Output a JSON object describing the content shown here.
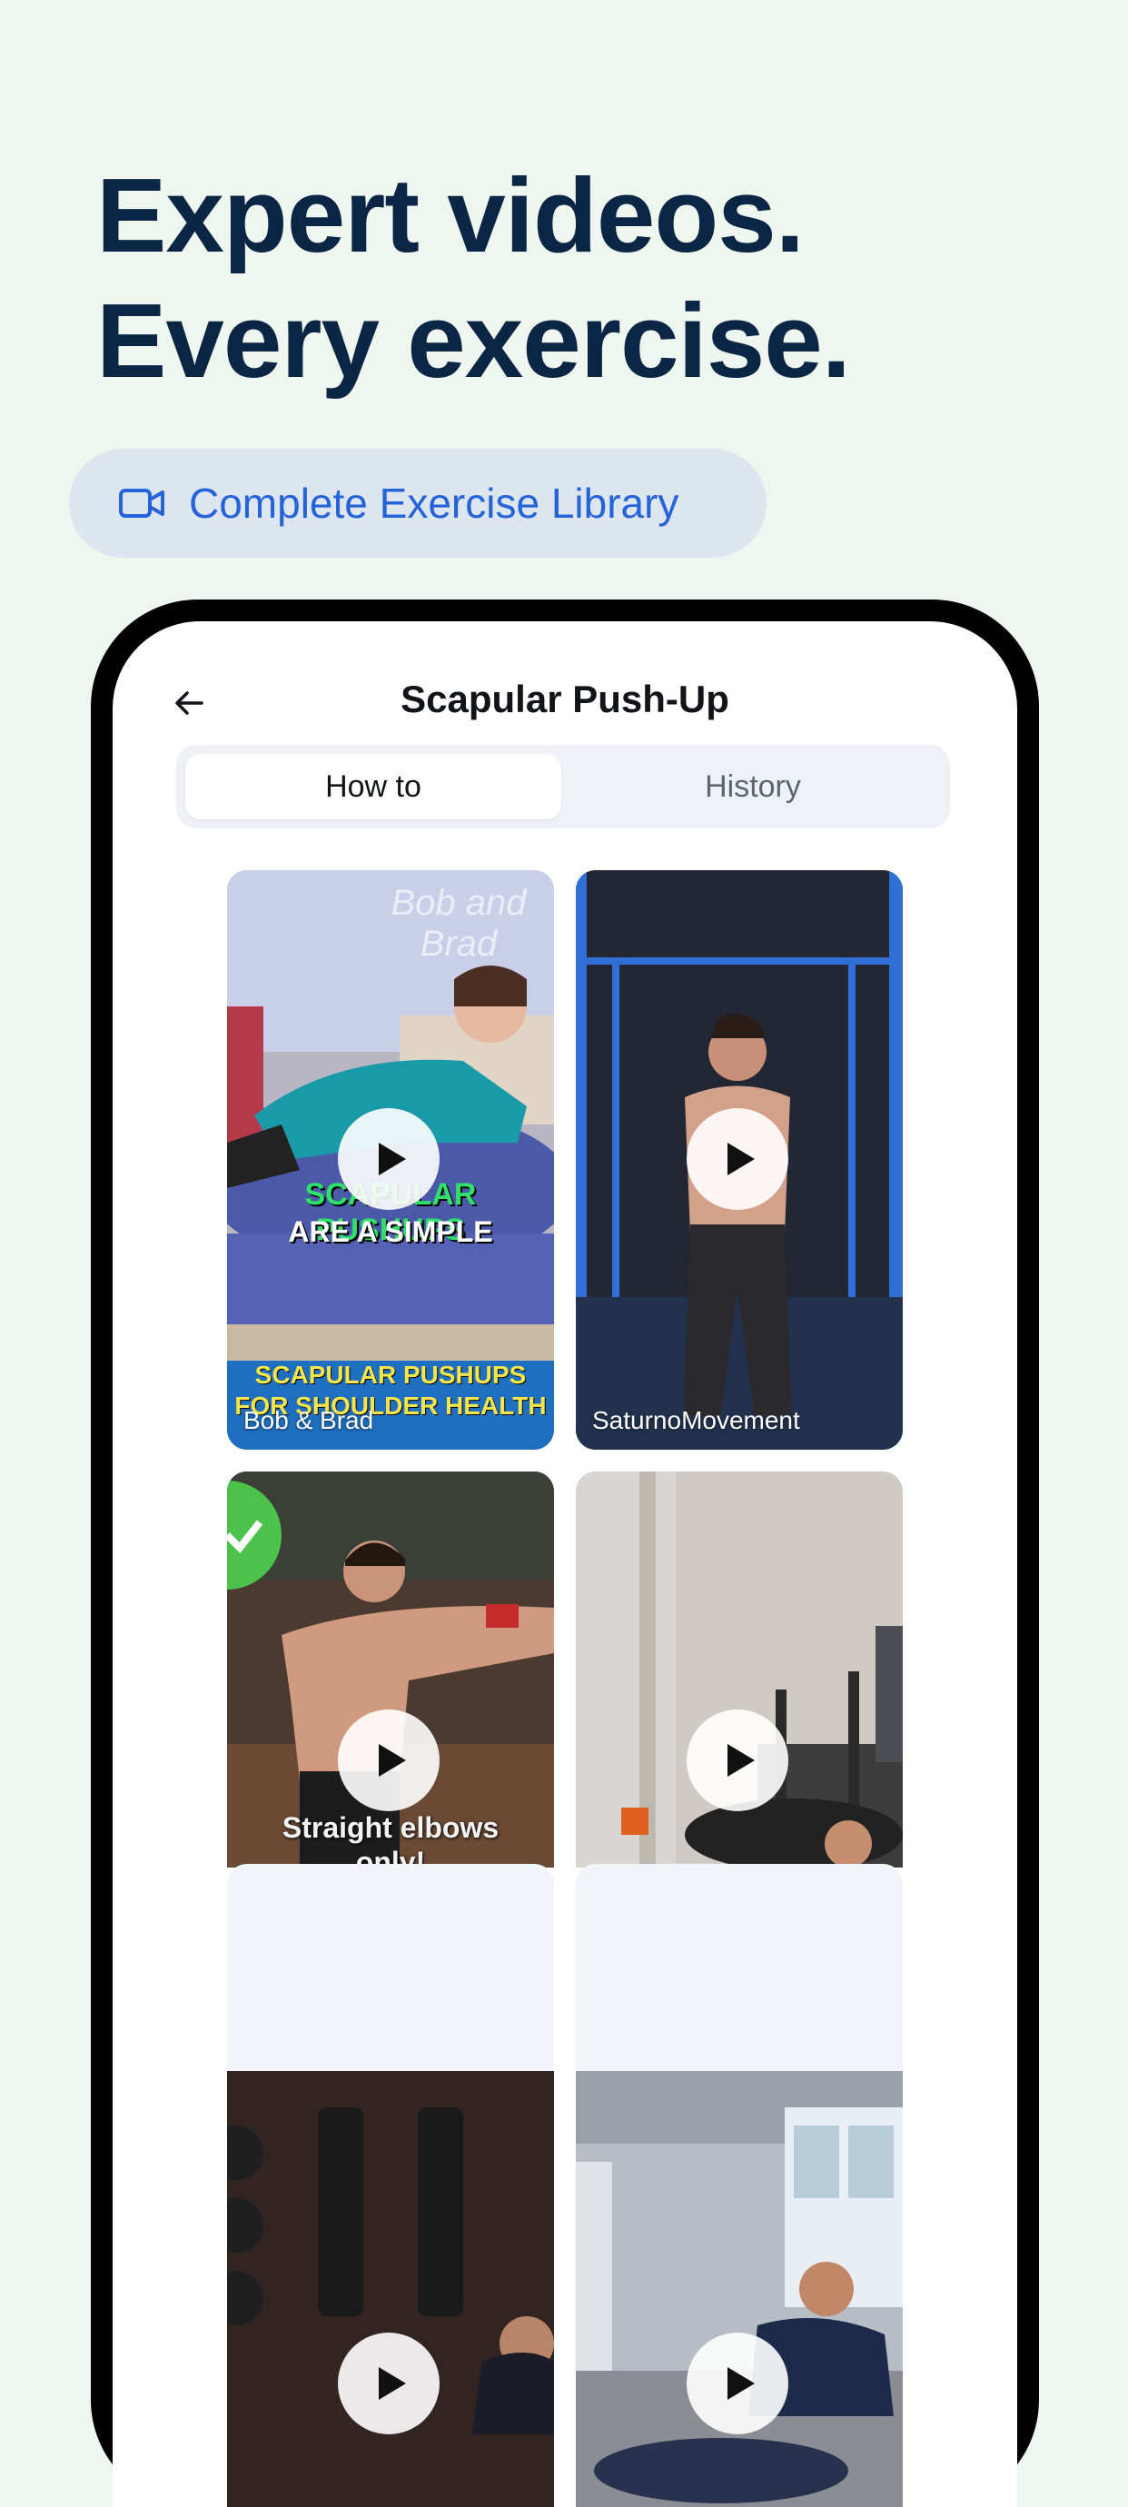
{
  "headline": {
    "line1": "Expert videos.",
    "line2": "Every exercise."
  },
  "library_pill": {
    "icon": "video-camera-icon",
    "label": "Complete Exercise Library"
  },
  "screen": {
    "title": "Scapular Push-Up",
    "back_icon": "back-arrow-icon",
    "tabs": [
      {
        "label": "How to",
        "active": true
      },
      {
        "label": "History",
        "active": false
      }
    ],
    "videos": [
      {
        "author": "Bob & Brad",
        "overlay_1": "SCAPULAR PUSHUPS",
        "overlay_2": "ARE A SIMPLE",
        "banner_1": "SCAPULAR PUSHUPS",
        "banner_2": "FOR SHOULDER HEALTH",
        "watermark": "Bob and Brad"
      },
      {
        "author": "SaturnoMovement"
      },
      {
        "author": "",
        "overlay_1": "Straight elbows",
        "overlay_2": "only!"
      },
      {
        "author": ""
      },
      {
        "author": ""
      },
      {
        "author": ""
      }
    ]
  },
  "colors": {
    "background": "#eff6ef",
    "headline": "#0b2545",
    "accent": "#2563d8",
    "pill_bg": "#dde6ef"
  }
}
